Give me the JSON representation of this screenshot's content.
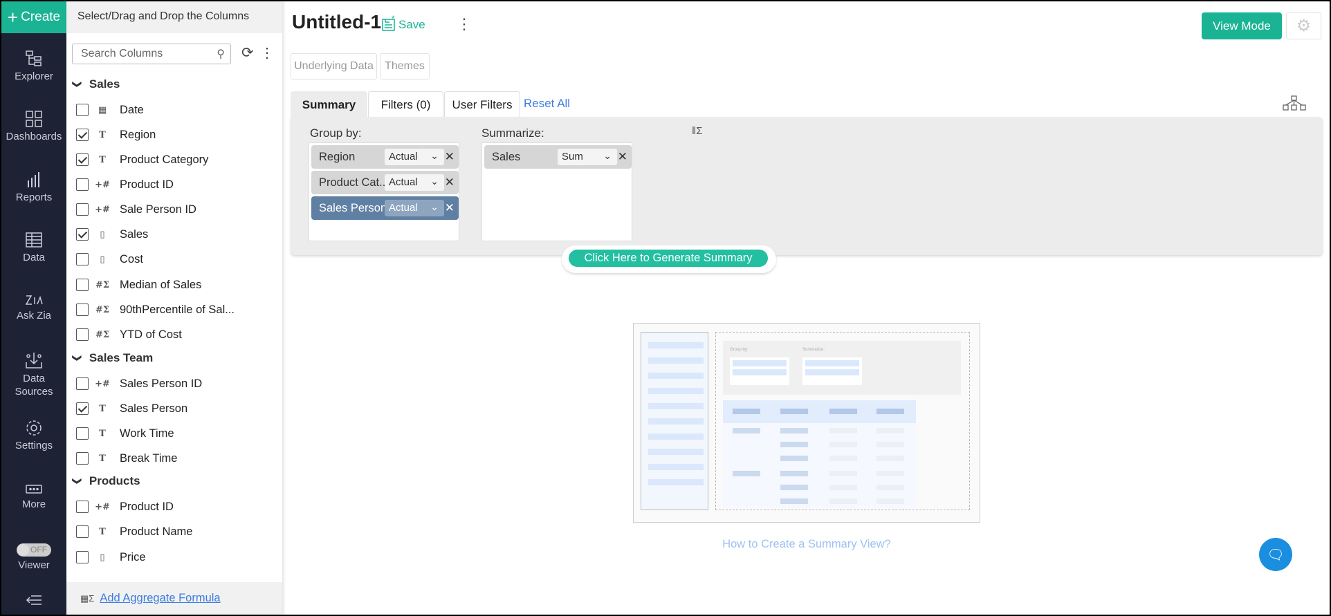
{
  "nav": {
    "create": "Create",
    "items": [
      {
        "label": "Explorer"
      },
      {
        "label": "Dashboards"
      },
      {
        "label": "Reports"
      },
      {
        "label": "Data"
      },
      {
        "label": "Ask Zia"
      },
      {
        "label": "Data",
        "label2": "Sources"
      },
      {
        "label": "Settings"
      },
      {
        "label": "More"
      },
      {
        "label": "Viewer"
      }
    ],
    "toggle": "OFF"
  },
  "columns": {
    "header": "Select/Drag and Drop the Columns",
    "search_placeholder": "Search Columns",
    "groups": [
      {
        "name": "Sales",
        "items": [
          {
            "label": "Date",
            "type": "17",
            "checked": false
          },
          {
            "label": "Region",
            "type": "T",
            "checked": true
          },
          {
            "label": "Product Category",
            "type": "T",
            "checked": true
          },
          {
            "label": "Product ID",
            "type": "+#",
            "checked": false
          },
          {
            "label": "Sale Person ID",
            "type": "+#",
            "checked": false
          },
          {
            "label": "Sales",
            "type": "$",
            "checked": true
          },
          {
            "label": "Cost",
            "type": "$",
            "checked": false
          },
          {
            "label": "Median of Sales",
            "type": "#Σ",
            "checked": false
          },
          {
            "label": "90thPercentile of Sal...",
            "type": "#Σ",
            "checked": false
          },
          {
            "label": "YTD of Cost",
            "type": "#Σ",
            "checked": false
          }
        ]
      },
      {
        "name": "Sales Team",
        "items": [
          {
            "label": "Sales Person ID",
            "type": "+#",
            "checked": false
          },
          {
            "label": "Sales Person",
            "type": "T",
            "checked": true
          },
          {
            "label": "Work Time",
            "type": "T",
            "checked": false
          },
          {
            "label": "Break Time",
            "type": "T",
            "checked": false
          }
        ]
      },
      {
        "name": "Products",
        "items": [
          {
            "label": "Product ID",
            "type": "+#",
            "checked": false
          },
          {
            "label": "Product Name",
            "type": "T",
            "checked": false
          },
          {
            "label": "Price",
            "type": "$",
            "checked": false
          }
        ]
      }
    ],
    "footer_link": "Add Aggregate Formula"
  },
  "header": {
    "title": "Untitled-1",
    "save": "Save",
    "view_mode": "View Mode",
    "underlying_data": "Underlying Data",
    "themes": "Themes"
  },
  "tabs": {
    "summary": "Summary",
    "filters": "Filters (0)",
    "user_filters": "User Filters",
    "reset_all": "Reset All"
  },
  "summary": {
    "group_by_label": "Group by:",
    "summarize_label": "Summarize:",
    "group_by": [
      {
        "column": "Region",
        "mode": "Actual"
      },
      {
        "column": "Product Cat...",
        "mode": "Actual"
      },
      {
        "column": "Sales Person",
        "mode": "Actual"
      }
    ],
    "summarize": [
      {
        "column": "Sales",
        "agg": "Sum"
      }
    ],
    "generate": "Click Here to Generate Summary"
  },
  "preview": {
    "group_by": "Group by:",
    "summarize": "Summarize:",
    "help_link": "How to Create a Summary View?"
  },
  "colors": {
    "accent": "#1ab394",
    "nav_bg": "#1e2235",
    "selected_pill": "#5f7fa3",
    "link": "#3b7de0"
  }
}
